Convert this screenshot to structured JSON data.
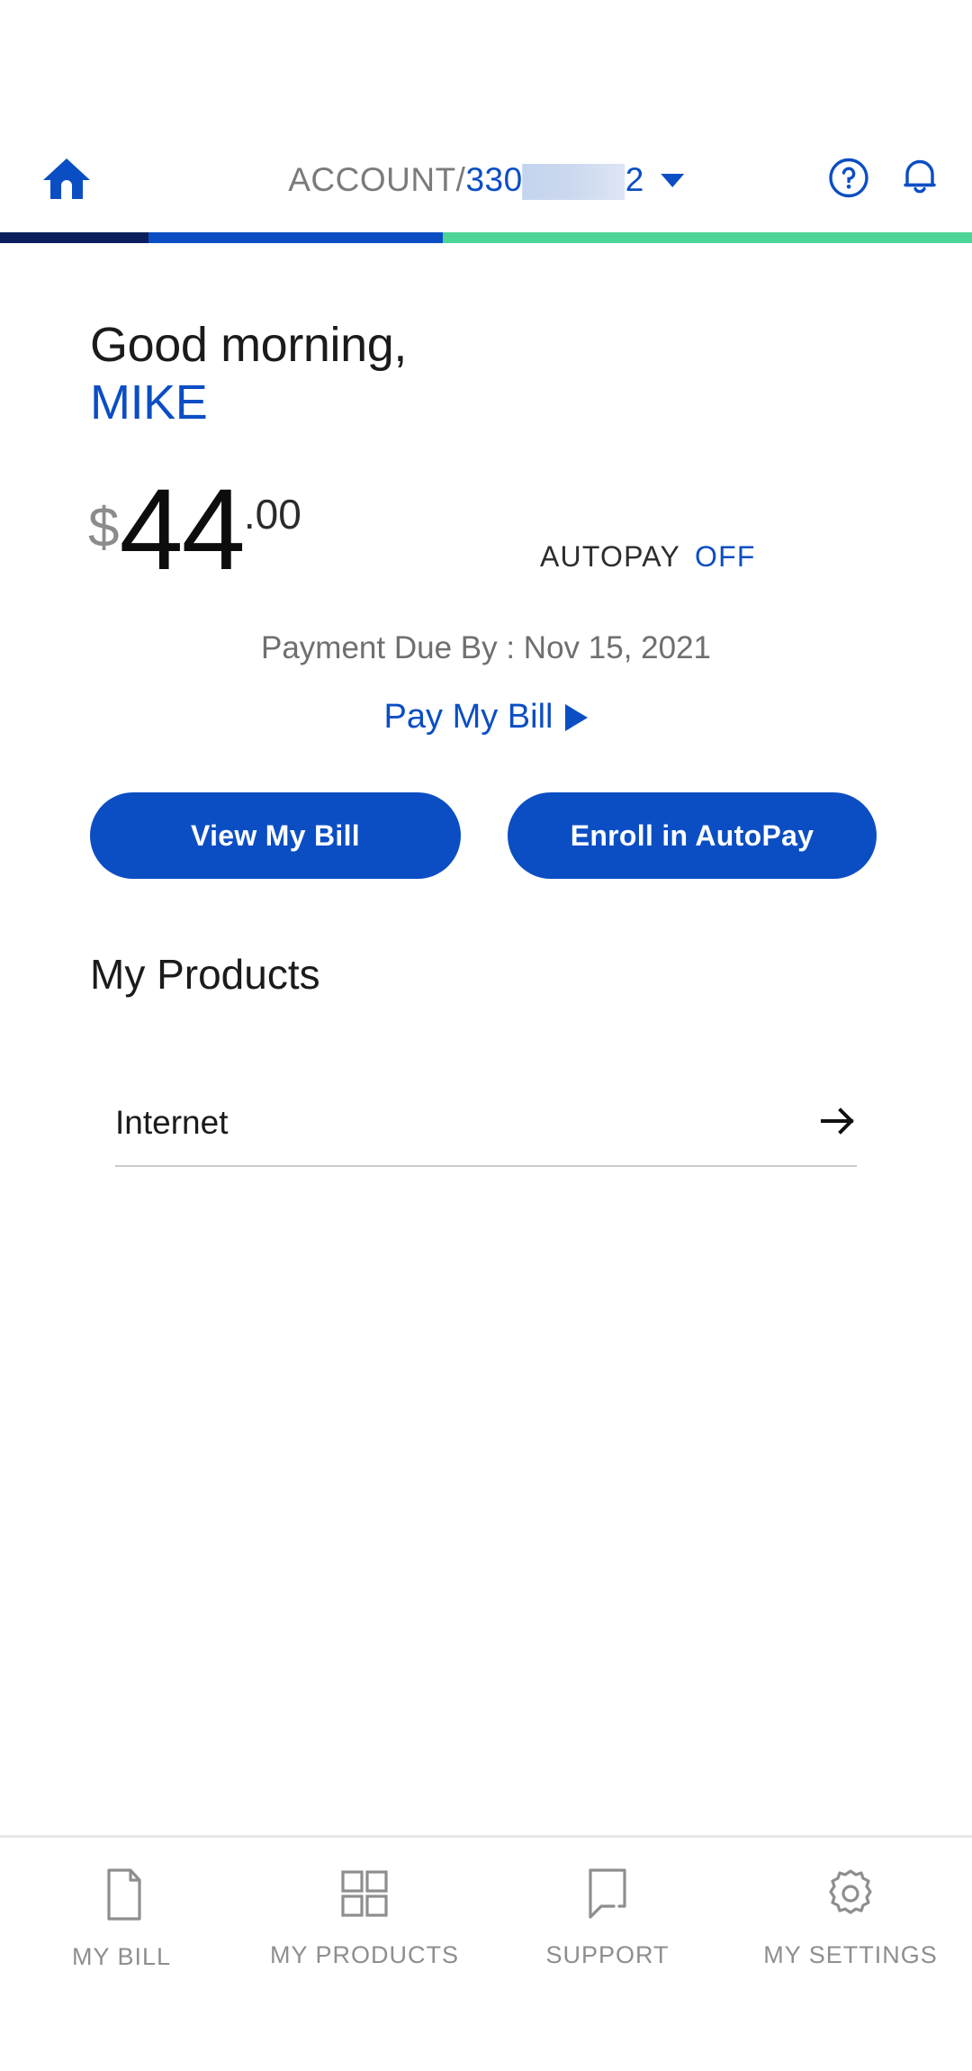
{
  "appbar": {
    "home_icon": "home-icon",
    "account_label": "ACCOUNT/",
    "account_number_visible": "330",
    "account_number_tail": "2",
    "account_masked": true,
    "dropdown_icon": "chevron-down-icon",
    "help_icon": "help-circle-icon",
    "notification_icon": "bell-icon"
  },
  "strip": {
    "segments": [
      {
        "name": "navy",
        "color": "#0a1f5c",
        "width_pct": 15.3
      },
      {
        "name": "blue",
        "color": "#0b4ec4",
        "width_pct": 30.3
      },
      {
        "name": "green",
        "color": "#4dd597",
        "width_pct": 54.4
      }
    ]
  },
  "greeting": {
    "salutation": "Good morning,",
    "name": "MIKE"
  },
  "balance": {
    "currency_symbol": "$",
    "dollars": "44",
    "cents": ".00",
    "autopay_label": "AUTOPAY",
    "autopay_status": "OFF",
    "due_text": "Payment Due By : Nov 15, 2021",
    "pay_link": "Pay My Bill",
    "pay_link_icon": "play-triangle-icon"
  },
  "cta": {
    "view_bill": "View My Bill",
    "enroll_autopay": "Enroll in AutoPay"
  },
  "products": {
    "title": "My Products",
    "items": [
      {
        "name": "Internet",
        "arrow_icon": "arrow-right-icon"
      }
    ]
  },
  "bottom_nav": {
    "items": [
      {
        "label": "MY BILL",
        "icon": "document-icon"
      },
      {
        "label": "MY PRODUCTS",
        "icon": "grid-squares-icon"
      },
      {
        "label": "SUPPORT",
        "icon": "speech-bubble-icon"
      },
      {
        "label": "MY SETTINGS",
        "icon": "gear-icon"
      }
    ]
  },
  "colors": {
    "brand_blue": "#0b4ec4",
    "navy": "#0a1f5c",
    "green": "#4dd597",
    "muted_gray": "#8e8e8e"
  }
}
